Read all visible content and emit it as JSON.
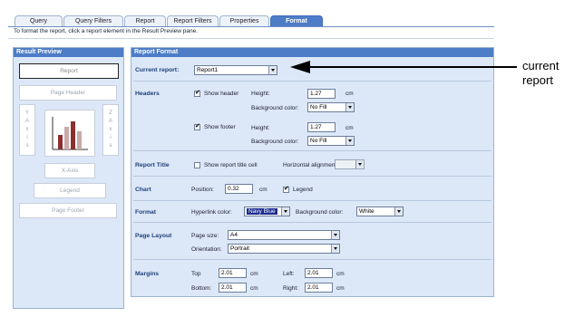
{
  "tabs": [
    {
      "label": "Query",
      "active": false
    },
    {
      "label": "Query Filters",
      "active": false
    },
    {
      "label": "Report",
      "active": false
    },
    {
      "label": "Report Filters",
      "active": false
    },
    {
      "label": "Properties",
      "active": false
    },
    {
      "label": "Format",
      "active": true
    }
  ],
  "hint": "To format the report, click a report element in the Result Preview pane.",
  "preview": {
    "title": "Result Preview",
    "report": "Report",
    "page_header": "Page Header",
    "y_axis": [
      "Y",
      "A",
      "x",
      "i",
      "s"
    ],
    "z_axis": [
      "Z",
      "A",
      "x",
      "i",
      "s"
    ],
    "x_axis": "X-Axis",
    "legend": "Legend",
    "page_footer": "Page Footer"
  },
  "format": {
    "title": "Report Format",
    "current_report_label": "Current report:",
    "current_report_value": "Report1",
    "headers": {
      "label": "Headers",
      "show_header": "Show header",
      "show_footer": "Show footer",
      "height_label": "Height:",
      "header_height": "1.27",
      "footer_height": "1.27",
      "unit": "cm",
      "bg_label": "Background color:",
      "header_bg": "No Fill",
      "footer_bg": "No Fill"
    },
    "report_title": {
      "label": "Report Title",
      "show_cell": "Show report title cell",
      "align_label": "Horizontal alignment"
    },
    "chart": {
      "label": "Chart",
      "position_label": "Position:",
      "position_value": "0.32",
      "unit": "cm",
      "legend": "Legend"
    },
    "format_row": {
      "label": "Format",
      "hyperlink_label": "Hyperlink color:",
      "hyperlink_value": "Navy Blue",
      "bg_label": "Background color:",
      "bg_value": "White"
    },
    "page_layout": {
      "label": "Page Layout",
      "size_label": "Page size:",
      "size_value": "A4",
      "orient_label": "Orientation:",
      "orient_value": "Portrait"
    },
    "margins": {
      "label": "Margins",
      "top_label": "Top",
      "top_value": "2.01",
      "bottom_label": "Bottom:",
      "bottom_value": "2.01",
      "left_label": "Left:",
      "left_value": "2.01",
      "right_label": "Right:",
      "right_value": "2.01",
      "unit": "cm"
    }
  },
  "annotation": {
    "line1": "current",
    "line2": "report"
  }
}
